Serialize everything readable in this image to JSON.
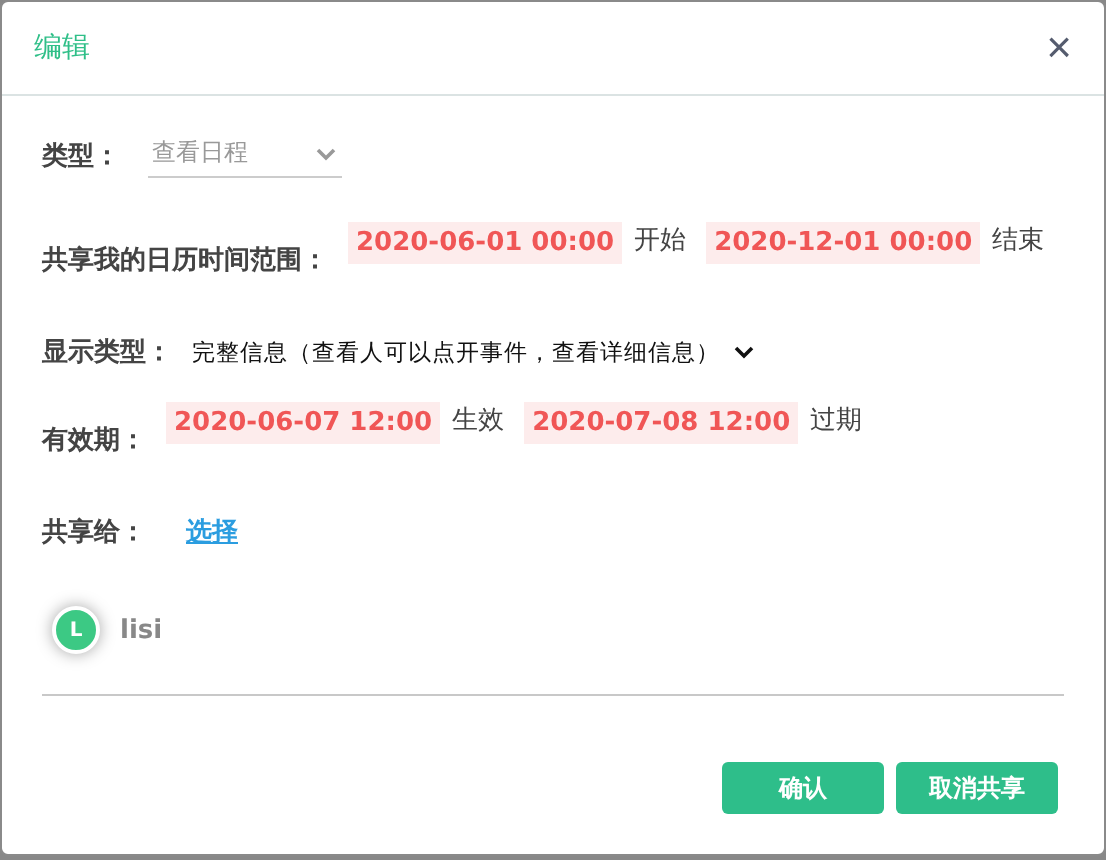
{
  "dialog": {
    "title": "编辑",
    "close": "×"
  },
  "type_field": {
    "label": "类型：",
    "placeholder": "查看日程"
  },
  "range": {
    "label": "共享我的日历时间范围：",
    "start": "2020-06-01 00:00",
    "start_suffix": "开始",
    "end": "2020-12-01 00:00",
    "end_suffix": "结束"
  },
  "display": {
    "label": "显示类型：",
    "value": "完整信息（查看人可以点开事件，查看详细信息）"
  },
  "validity": {
    "label": "有效期：",
    "start": "2020-06-07 12:00",
    "start_suffix": "生效",
    "end": "2020-07-08 12:00",
    "end_suffix": "过期"
  },
  "share": {
    "label": "共享给：",
    "link": "选择"
  },
  "users": [
    {
      "initial": "L",
      "name": "lisi",
      "color": "#3cc984"
    }
  ],
  "buttons": [
    "确认",
    "取消共享"
  ]
}
